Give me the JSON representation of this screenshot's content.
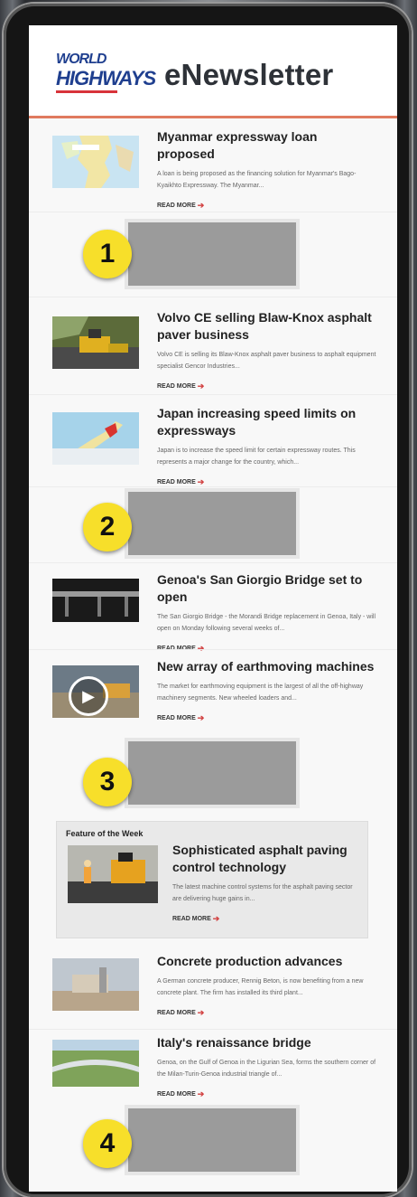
{
  "header": {
    "logo_line1": "WORLD",
    "logo_line2": "HIGHWAYS",
    "title": "eNewsletter"
  },
  "articles": [
    {
      "title": "Myanmar expressway loan proposed",
      "excerpt": "A loan is being proposed as the financing solution for Myanmar's Bago-Kyaikhto Expressway. The Myanmar...",
      "read_more": "READ MORE"
    },
    {
      "title": "Volvo CE selling Blaw-Knox asphalt paver business",
      "excerpt": "Volvo CE is selling its Blaw-Knox asphalt paver business to asphalt equipment specialist Gencor Industries...",
      "read_more": "READ MORE"
    },
    {
      "title": "Japan increasing speed limits on expressways",
      "excerpt": "Japan is to increase the speed limit for certain expressway routes. This represents a major change for the country, which...",
      "read_more": "READ MORE"
    },
    {
      "title": "Genoa's San Giorgio Bridge set to open",
      "excerpt": "The San Giorgio Bridge - the Morandi Bridge replacement in Genoa, Italy - will open on Monday following several weeks of...",
      "read_more": "READ MORE"
    },
    {
      "title": "New array of earthmoving machines",
      "excerpt": "The market for earthmoving equipment is the largest of all the off-highway machinery segments. New wheeled loaders and...",
      "read_more": "READ MORE"
    },
    {
      "title": "Concrete production advances",
      "excerpt": "A German concrete producer, Rennig Beton, is now benefiting from a new concrete plant. The firm has installed its third plant...",
      "read_more": "READ MORE"
    },
    {
      "title": "Italy's renaissance bridge",
      "excerpt": "Genoa, on the Gulf of Genoa in the Ligurian Sea, forms the southern corner of the Milan-Turin-Genoa industrial triangle of...",
      "read_more": "READ MORE"
    }
  ],
  "feature": {
    "label": "Feature of the Week",
    "title": "Sophisticated asphalt paving control technology",
    "excerpt": "The latest machine control systems for the asphalt paving sector are delivering huge gains in...",
    "read_more": "READ MORE"
  },
  "ad_badges": [
    "1",
    "2",
    "3",
    "4"
  ],
  "colors": {
    "accent_line": "#e07a5f",
    "read_more_arrow": "#d24141",
    "badge": "#f7df2a",
    "ad_placeholder": "#9b9b9b"
  },
  "icons": {
    "read_more_arrow": "arrow-right-icon",
    "video": "play-icon"
  }
}
